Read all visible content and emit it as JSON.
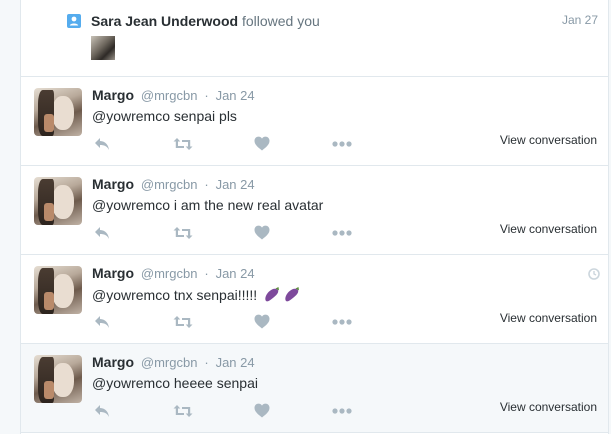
{
  "notification": {
    "user": "Sara Jean Underwood",
    "action": "followed you",
    "date": "Jan 27",
    "icon": "follow-person-icon"
  },
  "tweets": [
    {
      "name": "Margo",
      "handle": "@mrgcbn",
      "separator": "·",
      "date": "Jan 24",
      "text": "@yowremco senpai pls",
      "emoji": [],
      "view_conversation": "View conversation"
    },
    {
      "name": "Margo",
      "handle": "@mrgcbn",
      "separator": "·",
      "date": "Jan 24",
      "text": "@yowremco i am the new real avatar",
      "emoji": [],
      "view_conversation": "View conversation"
    },
    {
      "name": "Margo",
      "handle": "@mrgcbn",
      "separator": "·",
      "date": "Jan 24",
      "text": "@yowremco tnx senpai!!!!!",
      "emoji": [
        "eggplant-emoji",
        "eggplant-emoji"
      ],
      "view_conversation": "View conversation"
    },
    {
      "name": "Margo",
      "handle": "@mrgcbn",
      "separator": "·",
      "date": "Jan 24",
      "text": "@yowremco heeee senpai",
      "emoji": [],
      "view_conversation": "View conversation"
    }
  ],
  "icons": {
    "reply": "reply-icon",
    "retweet": "retweet-icon",
    "like": "heart-icon",
    "more": "more-dots-icon"
  },
  "colors": {
    "accent": "#55acee",
    "action_gray": "#aab8c2",
    "name_text": "#292f33",
    "meta_text": "#8899a6",
    "emoji_purple": "#7e4a9c"
  }
}
